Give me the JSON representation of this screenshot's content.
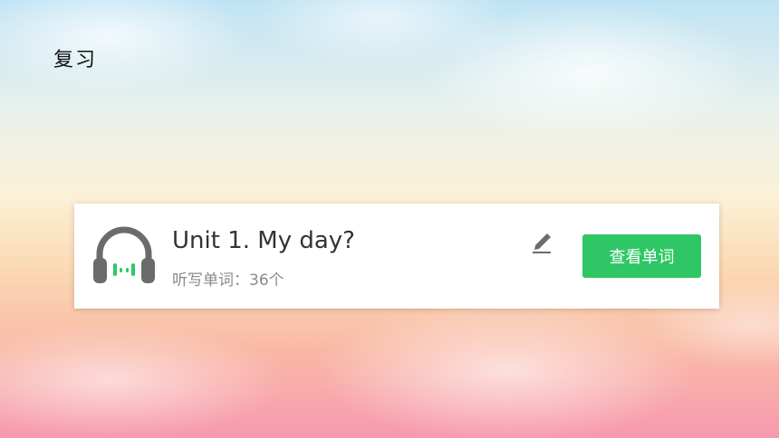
{
  "header": {
    "title": "复习"
  },
  "card": {
    "title": "Unit 1. My day?",
    "subtitle_label": "听写单词：",
    "subtitle_count": "36个",
    "view_button_label": "查看单词",
    "icons": {
      "audio": "headphones-icon",
      "edit": "pencil-icon"
    }
  },
  "colors": {
    "accent": "#2fc766",
    "icon_gray": "#6b6b6b",
    "audio_bars": "#2fc766"
  }
}
